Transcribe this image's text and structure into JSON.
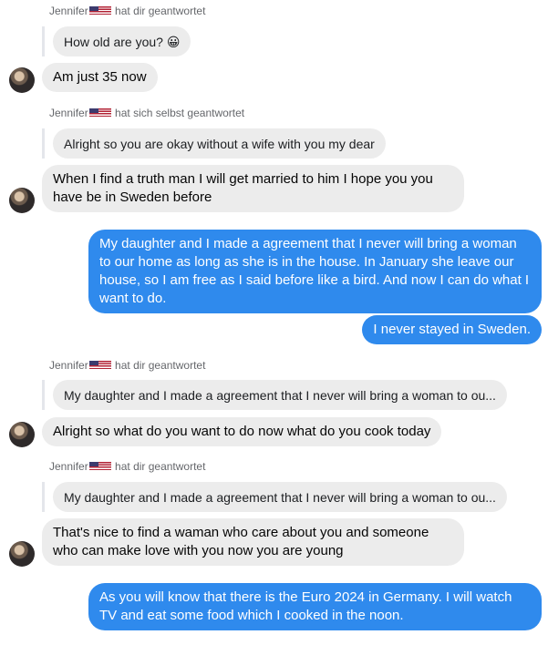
{
  "thread": {
    "sender_name": "Jennifer",
    "sender_flag": "us-uk-flags",
    "reply_to_you": "hat dir geantwortet",
    "reply_to_self": "hat sich selbst geantwortet"
  },
  "colors": {
    "incoming_bubble": "#ececec",
    "outgoing_bubble": "#2f8aed",
    "meta_text": "#65676b"
  },
  "messages": [
    {
      "reply_label": "Jennifer",
      "reply_suffix": "hat dir geantwortet",
      "quoted": "How old are you? 😀",
      "text": "Am just 35 now"
    },
    {
      "reply_label": "Jennifer",
      "reply_suffix": "hat sich selbst geantwortet",
      "quoted": "Alright so you are okay without a wife with you my dear",
      "text": "When I find a truth man I will get married to him I hope you you have be in Sweden before"
    },
    {
      "outgoing_1": "My daughter and I made a agreement that I never will bring a woman to our home as long as she is in the house. In January she leave our house, so I am free as I said before like a bird. And now I can do what I want to do.",
      "outgoing_2": "I never stayed in Sweden."
    },
    {
      "reply_label": "Jennifer",
      "reply_suffix": "hat dir geantwortet",
      "quoted": "My daughter and I made a agreement that I never will bring a woman to ou...",
      "text": "Alright so what do you want to do now what do you cook today"
    },
    {
      "reply_label": "Jennifer",
      "reply_suffix": "hat dir geantwortet",
      "quoted": "My daughter and I made a agreement that I never will bring a woman to ou...",
      "text": "That's nice to find a waman who care about you and someone who can make love with you now you are young"
    },
    {
      "outgoing_3": "As you will know that there is the Euro 2024 in Germany. I will watch TV and eat some food which I cooked in the noon."
    }
  ]
}
